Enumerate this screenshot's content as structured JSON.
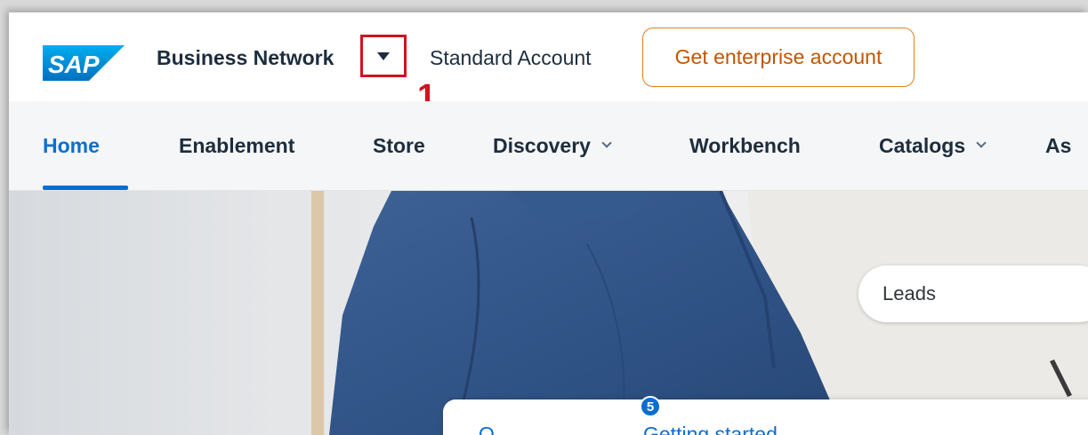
{
  "shellbar": {
    "logo_text": "SAP",
    "product_name": "Business Network",
    "account_type": "Standard Account",
    "upgrade_button": "Get enterprise account",
    "step_annotation": "1"
  },
  "nav": {
    "items": [
      {
        "label": "Home",
        "active": true
      },
      {
        "label": "Enablement"
      },
      {
        "label": "Store"
      },
      {
        "label": "Discovery",
        "has_dropdown": true
      },
      {
        "label": "Workbench"
      },
      {
        "label": "Catalogs",
        "has_dropdown": true
      },
      {
        "label": "As"
      }
    ]
  },
  "hero": {
    "search_value": "Leads",
    "card_tabs": [
      "O",
      "Getting started"
    ],
    "notification_count": "5"
  },
  "colors": {
    "accent": "#0a6ed1",
    "annotation_red": "#d0141f",
    "upgrade_orange": "#e57d1d",
    "text_dark": "#1d2d3e"
  },
  "icons": [
    "sap-logo",
    "caret-down-icon",
    "chevron-down-icon"
  ]
}
